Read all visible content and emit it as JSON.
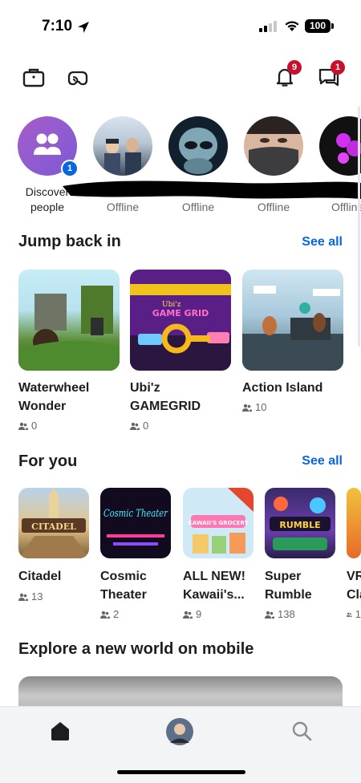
{
  "status_bar": {
    "time": "7:10",
    "battery": "100"
  },
  "top_nav": {
    "notifications_badge": "9",
    "messages_badge": "1"
  },
  "stories": {
    "discover_label": "Discover people",
    "discover_badge": "1",
    "items": [
      {
        "label": "Offline"
      },
      {
        "label": "Offline"
      },
      {
        "label": "Offline"
      },
      {
        "label": "Offline"
      }
    ]
  },
  "jump_back_in": {
    "title": "Jump back in",
    "see_all": "See all",
    "items": [
      {
        "title": "Waterwheel Wonder",
        "count": "0"
      },
      {
        "title": "Ubi'z GAMEGRID",
        "count": "0"
      },
      {
        "title": "Action Island",
        "count": "10"
      }
    ]
  },
  "for_you": {
    "title": "For you",
    "see_all": "See all",
    "items": [
      {
        "title": "Citadel",
        "count": "13",
        "thumb_text": "CITADEL"
      },
      {
        "title": "Cosmic Theater",
        "count": "2",
        "thumb_text": "Cosmic Theater"
      },
      {
        "title": "ALL NEW! Kawaii's...",
        "count": "9",
        "thumb_text": "KAWAII'S GROCERY"
      },
      {
        "title": "Super Rumble",
        "count": "138",
        "thumb_text": "RUMBLE"
      },
      {
        "title": "VR Cla...",
        "count": "1"
      }
    ]
  },
  "explore": {
    "title": "Explore a new world on mobile"
  },
  "thumb_texts": {
    "gamegrid": "GAME GRID",
    "ubiz": "Ubi'z"
  },
  "colors": {
    "accent": "#0a66e0",
    "badge": "#c8102e",
    "text": "#1c1e21",
    "muted": "#65676b"
  }
}
